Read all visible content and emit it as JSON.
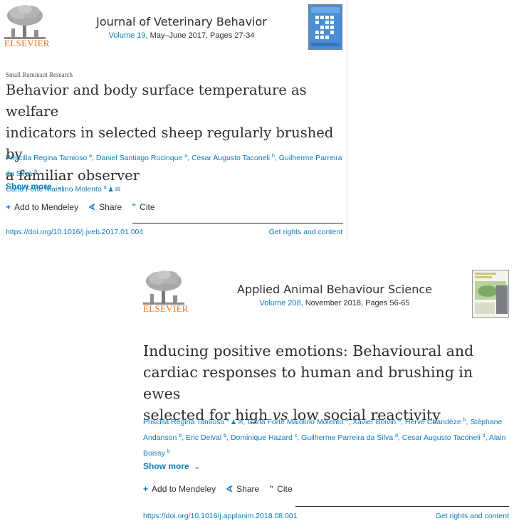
{
  "article1": {
    "publisher": "ELSEVIER",
    "journal": "Journal of Veterinary Behavior",
    "volume": "Volume 19",
    "issue_pages": ", May–June 2017, Pages 27-34",
    "category": "Small Ruminant Research",
    "title_lines": [
      "Behavior and body surface temperature as welfare",
      "indicators in selected sheep regularly brushed by",
      "a familiar observer"
    ],
    "authors": [
      {
        "name": "Priscilla Regina Tamioso",
        "sup": "a",
        "sep": ", "
      },
      {
        "name": "Daniel Santiago Rucinque",
        "sup": "a",
        "sep": ", "
      },
      {
        "name": "Cesar Augusto Taconeli",
        "sup": "b",
        "sep": ", "
      },
      {
        "name": "Guilherme Parreira da Silva",
        "sup": "b",
        "sep": ","
      },
      {
        "name": "Carla Forte Maiolino Molento",
        "sup": "a",
        "sep": ""
      }
    ],
    "show_more": "Show more",
    "actions": {
      "mendeley": "Add to Mendeley",
      "share": "Share",
      "cite": "Cite"
    },
    "doi": "https://doi.org/10.1016/j.jveb.2017.01.004",
    "rights": "Get rights and content"
  },
  "article2": {
    "publisher": "ELSEVIER",
    "journal": "Applied Animal Behaviour Science",
    "volume": "Volume 208",
    "issue_pages": ", November 2018, Pages 56-65",
    "title_line1": "Inducing positive emotions: Behavioural and",
    "title_line2": "cardiac responses to human and brushing in ewes",
    "title_line3_pre": "selected for high ",
    "title_line3_vs": "vs",
    "title_line3_post": " low social reactivity",
    "authors": [
      {
        "name": "Priscilla Regina Tamioso",
        "sup": "a"
      },
      {
        "name": "Carla Forte Maiolino Molento",
        "sup": "a"
      },
      {
        "name": "Xavier Boivin",
        "sup": "b"
      },
      {
        "name": "Hervé Chandèze",
        "sup": "b"
      },
      {
        "name": "Stéphane Andanson",
        "sup": "b"
      },
      {
        "name": "Eric Delval",
        "sup": "b"
      },
      {
        "name": "Dominique Hazard",
        "sup": "c"
      },
      {
        "name": "Guilherme Parreira da Silva",
        "sup": "d"
      },
      {
        "name": "Cesar Augusto Taconeli",
        "sup": "d"
      },
      {
        "name": "Alain Boissy",
        "sup": "b"
      }
    ],
    "show_more": "Show more",
    "actions": {
      "mendeley": "Add to Mendeley",
      "share": "Share",
      "cite": "Cite"
    },
    "doi": "https://doi.org/10.1016/j.applanim.2018.08.001",
    "rights": "Get rights and content"
  },
  "colors": {
    "link": "#0c7dbb",
    "elsevier_orange": "#e9711c",
    "text": "#2e2e2e"
  }
}
